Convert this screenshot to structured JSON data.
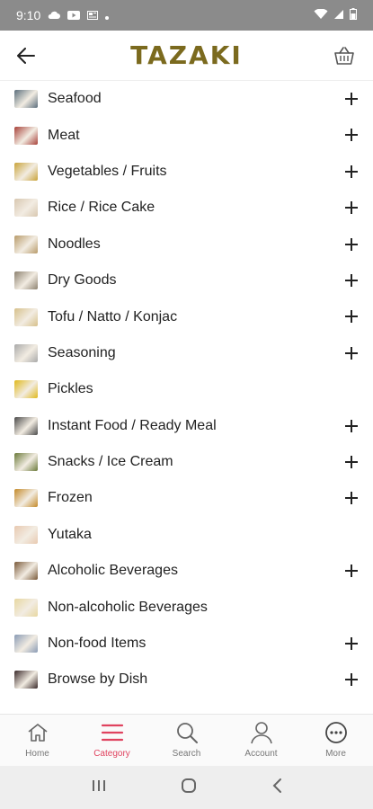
{
  "status_bar": {
    "time": "9:10"
  },
  "header": {
    "brand": "TAZAKI"
  },
  "categories": [
    {
      "label": "Seafood",
      "expandable": true,
      "thumb": "#5b6e7c"
    },
    {
      "label": "Meat",
      "expandable": true,
      "thumb": "#a8423a"
    },
    {
      "label": "Vegetables / Fruits",
      "expandable": true,
      "thumb": "#c9a33a"
    },
    {
      "label": "Rice / Rice Cake",
      "expandable": true,
      "thumb": "#d8c7b0"
    },
    {
      "label": "Noodles",
      "expandable": true,
      "thumb": "#b89b6a"
    },
    {
      "label": "Dry Goods",
      "expandable": true,
      "thumb": "#8d8270"
    },
    {
      "label": "Tofu / Natto / Konjac",
      "expandable": true,
      "thumb": "#d6c08a"
    },
    {
      "label": "Seasoning",
      "expandable": true,
      "thumb": "#a9a9a9"
    },
    {
      "label": "Pickles",
      "expandable": false,
      "thumb": "#e0b91c"
    },
    {
      "label": "Instant Food / Ready Meal",
      "expandable": true,
      "thumb": "#4a4a4a"
    },
    {
      "label": "Snacks / Ice Cream",
      "expandable": true,
      "thumb": "#6b7a3a"
    },
    {
      "label": "Frozen",
      "expandable": true,
      "thumb": "#c48a2a"
    },
    {
      "label": "Yutaka",
      "expandable": false,
      "thumb": "#e8c9b0"
    },
    {
      "label": "Alcoholic Beverages",
      "expandable": true,
      "thumb": "#7a5a3a"
    },
    {
      "label": "Non-alcoholic Beverages",
      "expandable": false,
      "thumb": "#e7d7a0"
    },
    {
      "label": "Non-food Items",
      "expandable": true,
      "thumb": "#8a9bb5"
    },
    {
      "label": "Browse by Dish",
      "expandable": true,
      "thumb": "#3a2a2a"
    }
  ],
  "bottom_nav": [
    {
      "label": "Home",
      "icon": "home-icon",
      "active": false
    },
    {
      "label": "Category",
      "icon": "menu-icon",
      "active": true
    },
    {
      "label": "Search",
      "icon": "search-icon",
      "active": false
    },
    {
      "label": "Account",
      "icon": "account-icon",
      "active": false
    },
    {
      "label": "More",
      "icon": "more-icon",
      "active": false
    }
  ],
  "colors": {
    "accent": "#e0435f",
    "brand": "#7b6a1e",
    "status_bar": "#8b8b8b"
  }
}
